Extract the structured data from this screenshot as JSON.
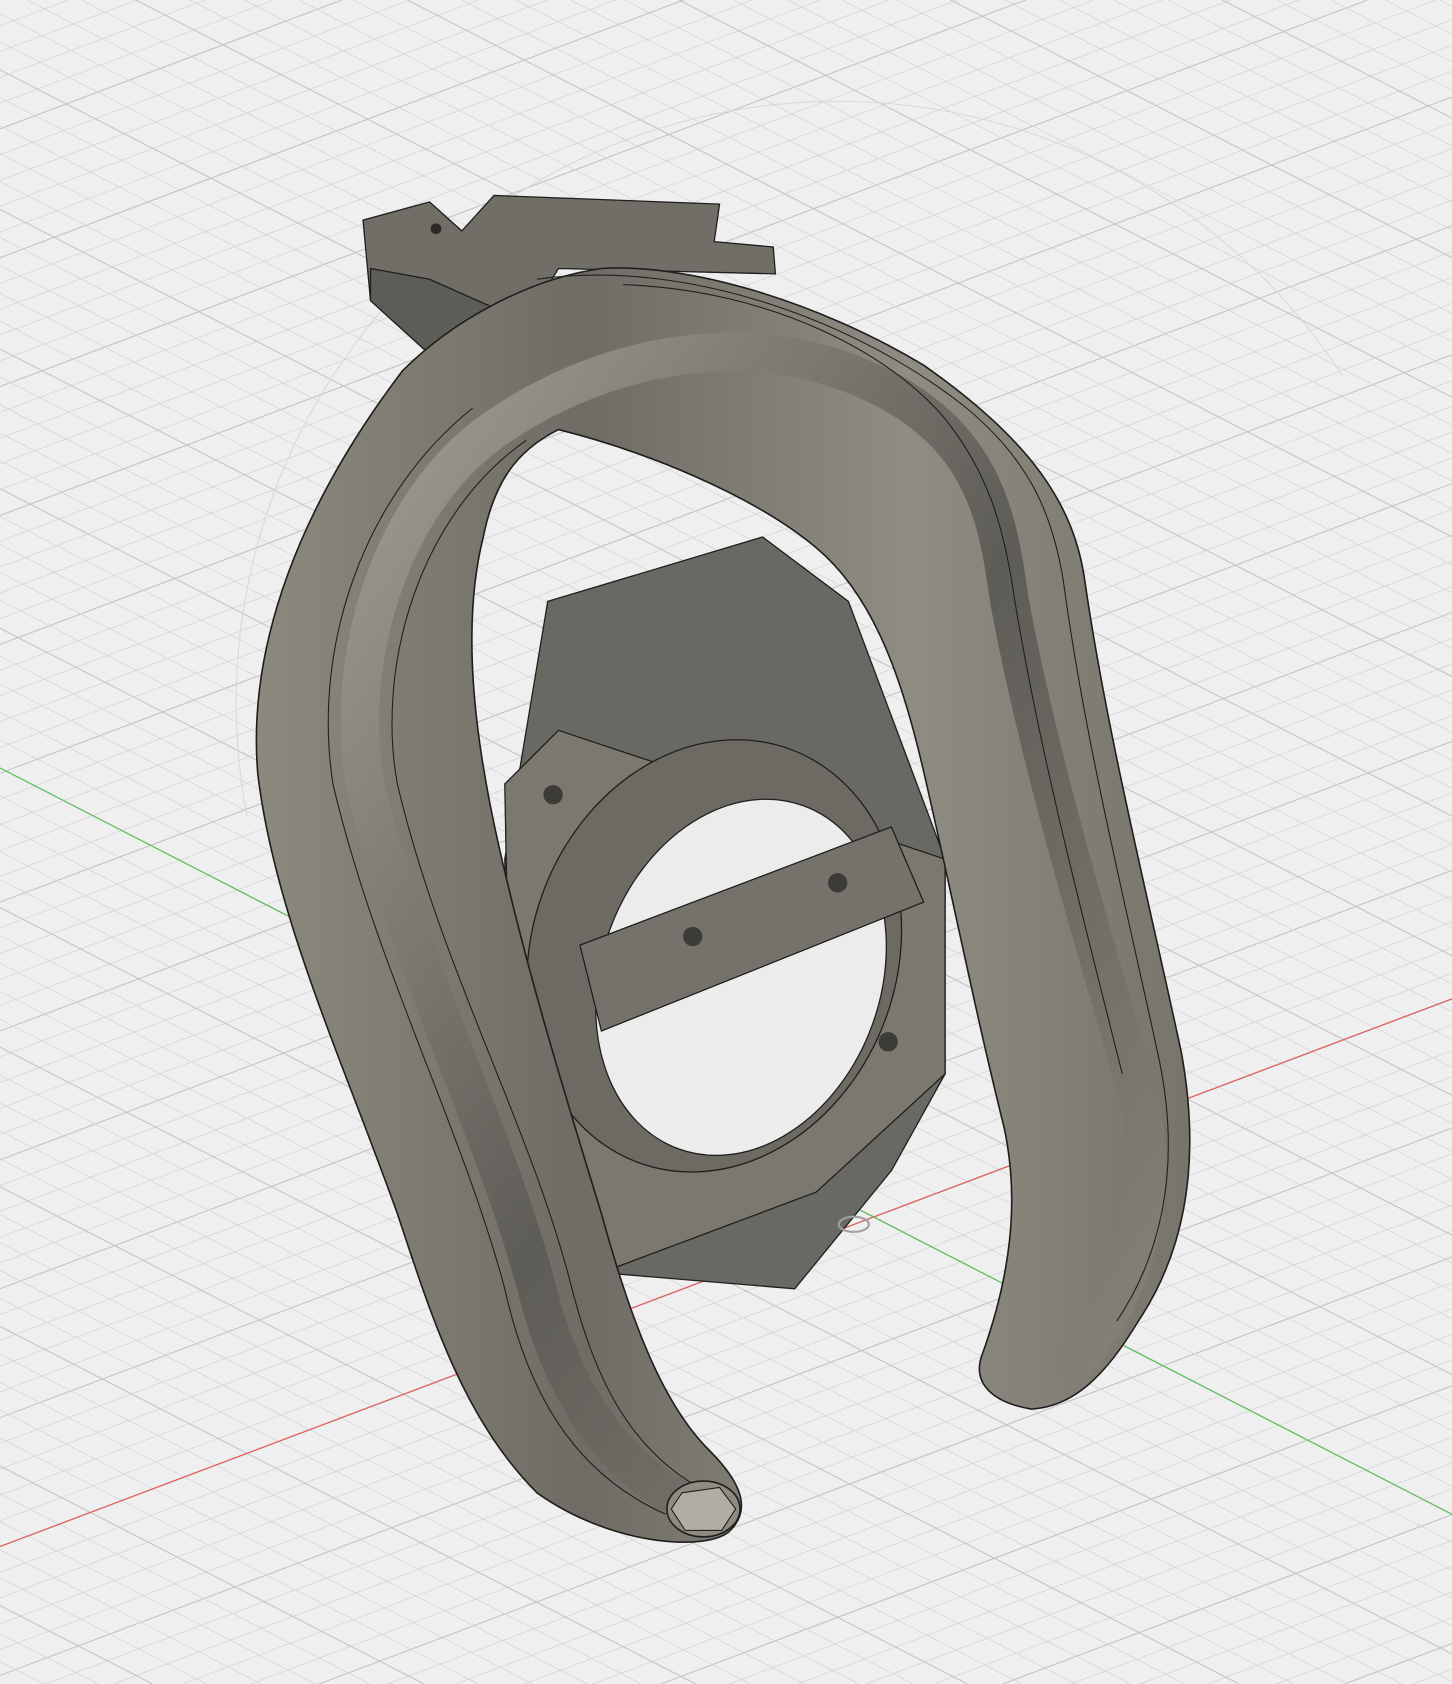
{
  "viewport": {
    "background_color": "#efefef",
    "grid_color": "#d4d4d4",
    "grid_major_color": "#c4c4c4",
    "x_axis_color": "#e06060",
    "y_axis_color": "#60c060",
    "model_color": "#7e7b73",
    "model_dark_color": "#5a5852",
    "model_light_color": "#9c998f",
    "edge_color": "#1e1e1c"
  }
}
